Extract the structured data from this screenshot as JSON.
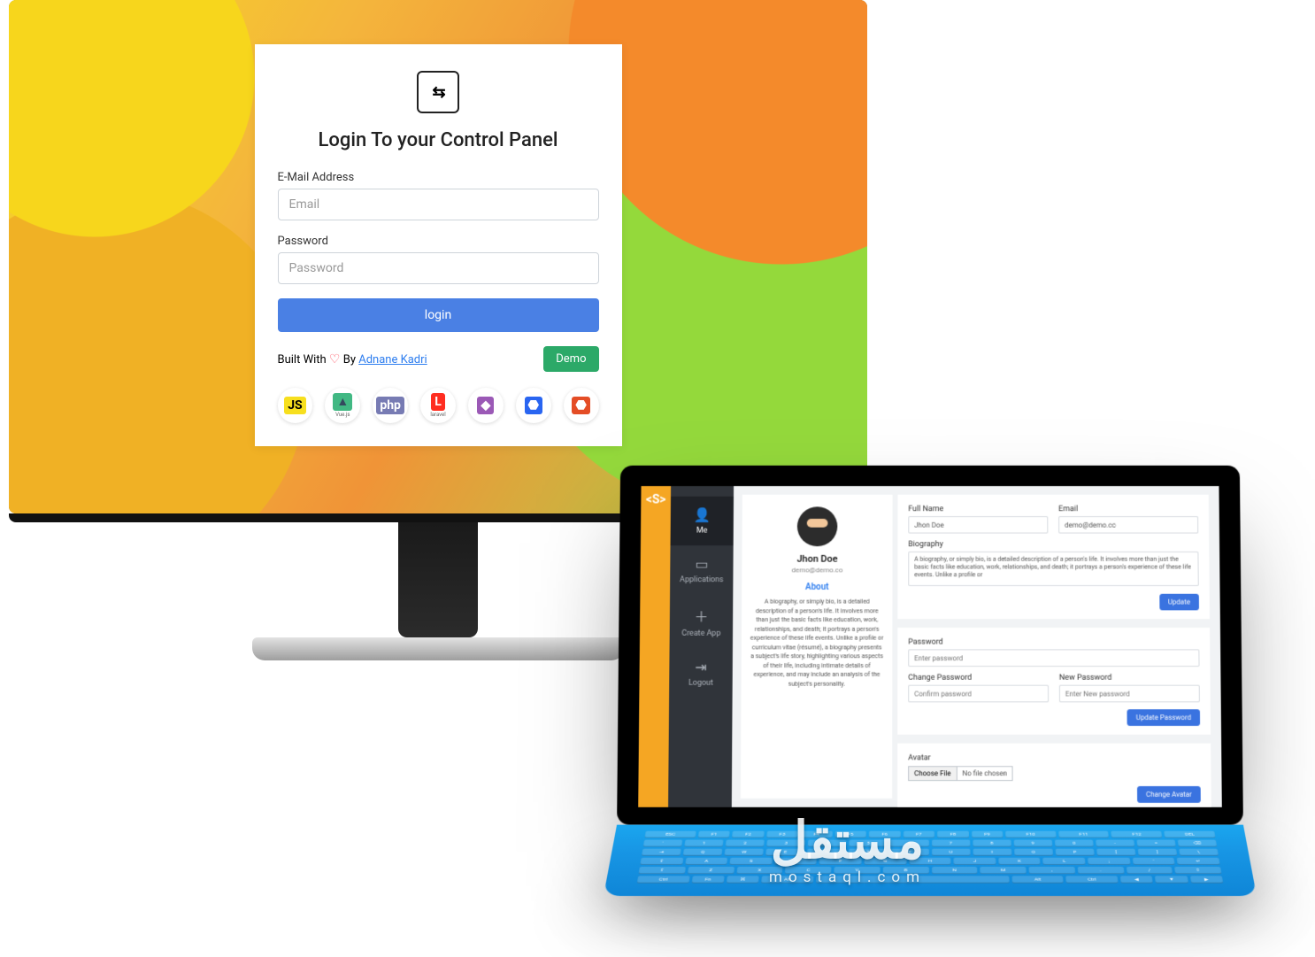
{
  "monitor": {
    "title": "Login To your Control Panel",
    "email_label": "E-Mail Address",
    "email_placeholder": "Email",
    "password_label": "Password",
    "password_placeholder": "Password",
    "login_button": "login",
    "built_prefix": "Built With",
    "built_by": "By",
    "author": "Adnane Kadri",
    "demo_button": "Demo",
    "tech": [
      {
        "icon": "JS",
        "label": "",
        "color": "#f7df1e",
        "fg": "#000"
      },
      {
        "icon": "▲",
        "label": "Vue.js",
        "color": "#41b883",
        "fg": "#34495e"
      },
      {
        "icon": "php",
        "label": "",
        "color": "#777bb3",
        "fg": "#fff"
      },
      {
        "icon": "L",
        "label": "laravel",
        "color": "#ff2d20",
        "fg": "#fff"
      },
      {
        "icon": "◆",
        "label": "",
        "color": "#9b59b6",
        "fg": "#fff"
      },
      {
        "icon": "⬣",
        "label": "",
        "color": "#2965f1",
        "fg": "#fff"
      },
      {
        "icon": "⬣",
        "label": "",
        "color": "#e44d26",
        "fg": "#fff"
      }
    ]
  },
  "laptop": {
    "nav": [
      {
        "icon": "👤",
        "label": "Me"
      },
      {
        "icon": "▭",
        "label": "Applications"
      },
      {
        "icon": "＋",
        "label": "Create App"
      },
      {
        "icon": "⇥",
        "label": "Logout"
      }
    ],
    "profile": {
      "name": "Jhon Doe",
      "email": "demo@demo.co",
      "about_heading": "About",
      "about_text": "A biography, or simply bio, is a detailed description of a person's life. It involves more than just the basic facts like education, work, relationships, and death; it portrays a person's experience of these life events. Unlike a profile or curriculum vitae (résumé), a biography presents a subject's life story, highlighting various aspects of their life, including intimate details of experience, and may include an analysis of the subject's personality."
    },
    "info_panel": {
      "fullname_label": "Full Name",
      "fullname_value": "Jhon Doe",
      "email_label": "Email",
      "email_value": "demo@demo.co",
      "bio_label": "Biography",
      "bio_value": "A biography, or simply bio, is a detailed description of a person's life. It involves more than just the basic facts like education, work, relationships, and death; it portrays a person's experience of these life events. Unlike a profile or",
      "update_button": "Update"
    },
    "password_panel": {
      "password_label": "Password",
      "password_placeholder": "Enter password",
      "change_label": "Change Password",
      "change_placeholder": "Confirm password",
      "new_label": "New Password",
      "new_placeholder": "Enter New password",
      "update_button": "Update Password"
    },
    "avatar_panel": {
      "heading": "Avatar",
      "choose_button": "Choose File",
      "no_file": "No file chosen",
      "change_button": "Change Avatar"
    }
  },
  "watermark": {
    "ar": "مستقل",
    "en": "mostaql.com"
  },
  "keyboard": {
    "r1": [
      "ESC",
      "F1",
      "F2",
      "F3",
      "F4",
      "F5",
      "F6",
      "F7",
      "F8",
      "F9",
      "F10",
      "F11",
      "F12",
      "DEL"
    ],
    "r2": [
      "`",
      "1",
      "2",
      "3",
      "4",
      "5",
      "6",
      "7",
      "8",
      "9",
      "0",
      "-",
      "=",
      "⌫"
    ],
    "r3": [
      "⇥",
      "Q",
      "W",
      "E",
      "R",
      "T",
      "Y",
      "U",
      "I",
      "O",
      "P",
      "[",
      "]",
      "\\"
    ],
    "r4": [
      "⇪",
      "A",
      "S",
      "D",
      "F",
      "G",
      "H",
      "J",
      "K",
      "L",
      ";",
      "'",
      "↵"
    ],
    "r5": [
      "⇧",
      "Z",
      "X",
      "C",
      "V",
      "B",
      "N",
      "M",
      ",",
      ".",
      "/",
      "⇧"
    ],
    "r6": [
      "Ctrl",
      "Fn",
      "⌘",
      "Alt",
      "",
      "Alt",
      "Ctrl",
      "◀",
      "▼",
      "▶"
    ]
  }
}
